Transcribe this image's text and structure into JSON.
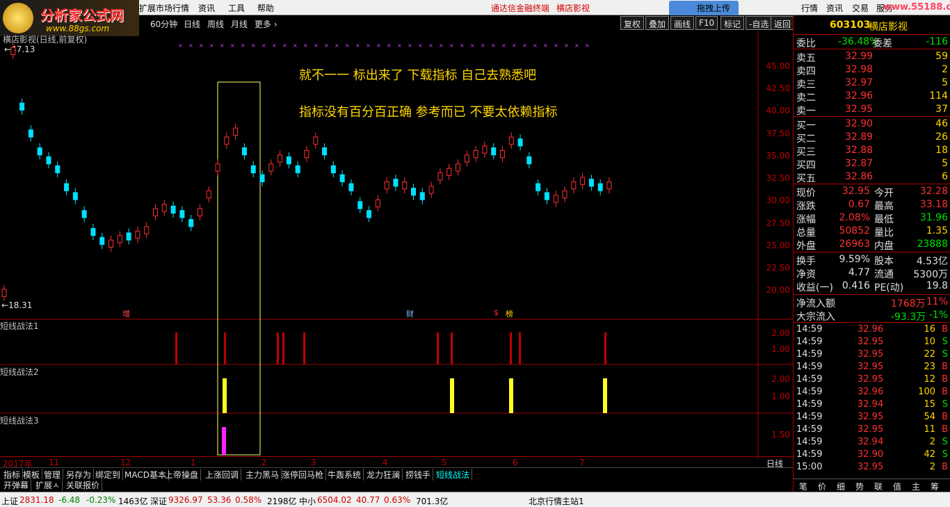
{
  "logo": {
    "title": "分析家公式网",
    "url": "www.88gs.com"
  },
  "menu": {
    "items": [
      "扩展市场行情",
      "资讯",
      "工具",
      "帮助"
    ],
    "promo1": "通达信金融终端",
    "promo2": "横店影视",
    "upload": "拖拽上传",
    "right_items": [
      "行情",
      "资讯",
      "交易",
      "服务"
    ],
    "watermark": "www.55188.com"
  },
  "period": {
    "items": [
      "60分钟",
      "日线",
      "周线",
      "月线",
      "更多 ›"
    ],
    "tools": [
      "复权",
      "叠加",
      "画线",
      "F10",
      "标记",
      "-自选",
      "返回"
    ]
  },
  "chart": {
    "header": "横店影视(日线,前复权)",
    "high_label": "47.13",
    "low_label": "18.31",
    "annotations": [
      "就不一一 标出来了      下载指标 自己去熟悉吧",
      "指标没有百分百正确      参考而已 不要太依赖指标"
    ],
    "price_ticks": [
      "45.00",
      "42.50",
      "40.00",
      "37.50",
      "35.00",
      "32.50",
      "30.00",
      "27.50",
      "25.00",
      "22.50",
      "20.00"
    ],
    "event_marks": [
      "增",
      "财",
      "$",
      "榜"
    ],
    "panels": [
      {
        "name": "短线战法1",
        "ticks": [
          "2.00",
          "1.00"
        ]
      },
      {
        "name": "短线战法2",
        "ticks": [
          "2.00",
          "1.00"
        ]
      },
      {
        "name": "短线战法3",
        "ticks": [
          "1.50"
        ]
      }
    ],
    "months": [
      "2017年",
      "11",
      "12",
      "1",
      "2",
      "3",
      "4",
      "5",
      "6",
      "7"
    ],
    "period_label": "日线"
  },
  "tabs": [
    "指标",
    "模板",
    "管理",
    "另存为",
    "绑定到",
    "MACD基本",
    "上帝操盘",
    "上涨回调",
    "主力黑马",
    "涨停回马枪",
    "牛轰系统",
    "龙力狂澜",
    "捞钱手",
    "短线战法"
  ],
  "tabs2": [
    "开弹幕",
    "扩展ㅅ",
    "关联报价"
  ],
  "quote": {
    "code": "603103",
    "name": "横店影视",
    "weibi_label": "委比",
    "weibi": "-36.48%",
    "weicha_label": "委差",
    "weicha": "-116",
    "sells": [
      {
        "l": "卖五",
        "p": "32.99",
        "v": "59"
      },
      {
        "l": "卖四",
        "p": "32.98",
        "v": "2"
      },
      {
        "l": "卖三",
        "p": "32.97",
        "v": "5"
      },
      {
        "l": "卖二",
        "p": "32.96",
        "v": "114"
      },
      {
        "l": "卖一",
        "p": "32.95",
        "v": "37"
      }
    ],
    "buys": [
      {
        "l": "买一",
        "p": "32.90",
        "v": "46"
      },
      {
        "l": "买二",
        "p": "32.89",
        "v": "26"
      },
      {
        "l": "买三",
        "p": "32.88",
        "v": "18"
      },
      {
        "l": "买四",
        "p": "32.87",
        "v": "5"
      },
      {
        "l": "买五",
        "p": "32.86",
        "v": "6"
      }
    ],
    "stats": [
      {
        "a": "现价",
        "av": "32.95",
        "b": "今开",
        "bv": "32.28"
      },
      {
        "a": "涨跌",
        "av": "0.67",
        "b": "最高",
        "bv": "33.18"
      },
      {
        "a": "涨幅",
        "av": "2.08%",
        "b": "最低",
        "bv": "31.96"
      },
      {
        "a": "总量",
        "av": "50852",
        "b": "量比",
        "bv": "1.35"
      },
      {
        "a": "外盘",
        "av": "26963",
        "b": "内盘",
        "bv": "23888"
      }
    ],
    "stats2": [
      {
        "a": "换手",
        "av": "9.59%",
        "b": "股本",
        "bv": "4.53亿"
      },
      {
        "a": "净资",
        "av": "4.77",
        "b": "流通",
        "bv": "5300万"
      },
      {
        "a": "收益(一)",
        "av": "0.416",
        "b": "PE(动)",
        "bv": "19.8"
      }
    ],
    "flow": [
      {
        "l": "净流入额",
        "v": "1768万",
        "p": "11%"
      },
      {
        "l": "大宗流入",
        "v": "-93.3万",
        "p": "-1%"
      }
    ],
    "ticks": [
      {
        "t": "14:59",
        "p": "32.96",
        "v": "16",
        "s": "B"
      },
      {
        "t": "14:59",
        "p": "32.95",
        "v": "10",
        "s": "S"
      },
      {
        "t": "14:59",
        "p": "32.95",
        "v": "22",
        "s": "S"
      },
      {
        "t": "14:59",
        "p": "32.95",
        "v": "23",
        "s": "B"
      },
      {
        "t": "14:59",
        "p": "32.95",
        "v": "12",
        "s": "B"
      },
      {
        "t": "14:59",
        "p": "32.96",
        "v": "100",
        "s": "B"
      },
      {
        "t": "14:59",
        "p": "32.94",
        "v": "15",
        "s": "S"
      },
      {
        "t": "14:59",
        "p": "32.95",
        "v": "54",
        "s": "B"
      },
      {
        "t": "14:59",
        "p": "32.95",
        "v": "11",
        "s": "B"
      },
      {
        "t": "14:59",
        "p": "32.94",
        "v": "2",
        "s": "S"
      },
      {
        "t": "14:59",
        "p": "32.90",
        "v": "42",
        "s": "S"
      },
      {
        "t": "15:00",
        "p": "32.95",
        "v": "2",
        "s": "B"
      }
    ],
    "bottom_tabs": [
      "笔",
      "价",
      "细",
      "势",
      "联",
      "值",
      "主",
      "筹"
    ]
  },
  "status": {
    "sh_label": "上证",
    "sh": "2831.18",
    "sh_chg": "-6.48",
    "sh_pct": "-0.23%",
    "sh_amt": "1463亿",
    "sz_label": "深证",
    "sz": "9326.97",
    "sz_chg": "53.36",
    "sz_pct": "0.58%",
    "sz_amt": "2198亿",
    "zx_label": "中小",
    "zx": "6504.02",
    "zx_chg": "40.77",
    "zx_pct": "0.63%",
    "zx_amt": "701.3亿",
    "news": "北京行情主站1"
  }
}
